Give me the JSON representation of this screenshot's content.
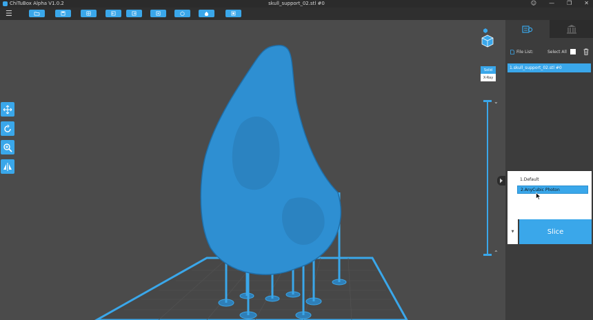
{
  "titlebar": {
    "app_name": "ChiTuBox Alpha V1.0.2",
    "file_title": "skull_support_02.stl #0",
    "controls": [
      "user-icon",
      "minimize-icon",
      "restore-icon",
      "close-icon"
    ]
  },
  "toolbar": {
    "menu_icon": "hamburger-icon",
    "buttons": [
      "open-folder-icon",
      "save-icon",
      "layout-icon",
      "undo-icon",
      "redo-icon",
      "zoom-fit-icon",
      "arrange-icon",
      "hollow-icon",
      "support-icon"
    ]
  },
  "viewport": {
    "view_modes": {
      "solid": "Solid",
      "xray": "X-Ray"
    },
    "left_tools": [
      "move-icon",
      "rotate-icon",
      "scale-icon",
      "mirror-icon"
    ]
  },
  "panel": {
    "tabs": [
      "settings-icon",
      "supports-icon"
    ],
    "file_list_label": "File List:",
    "select_all_label": "Select All",
    "files": [
      "1.skull_support_02.stl #0"
    ],
    "profiles": [
      "1.Default",
      "2.AnyCubic Photon"
    ],
    "selected_profile": "2.AnyCubic Photon",
    "slice_label": "Slice"
  },
  "colors": {
    "accent": "#3aa7ea",
    "viewport_bg": "#4b4b4b",
    "panel_bg": "#3c3c3c",
    "toolbar_bg": "#2f2f2f"
  }
}
